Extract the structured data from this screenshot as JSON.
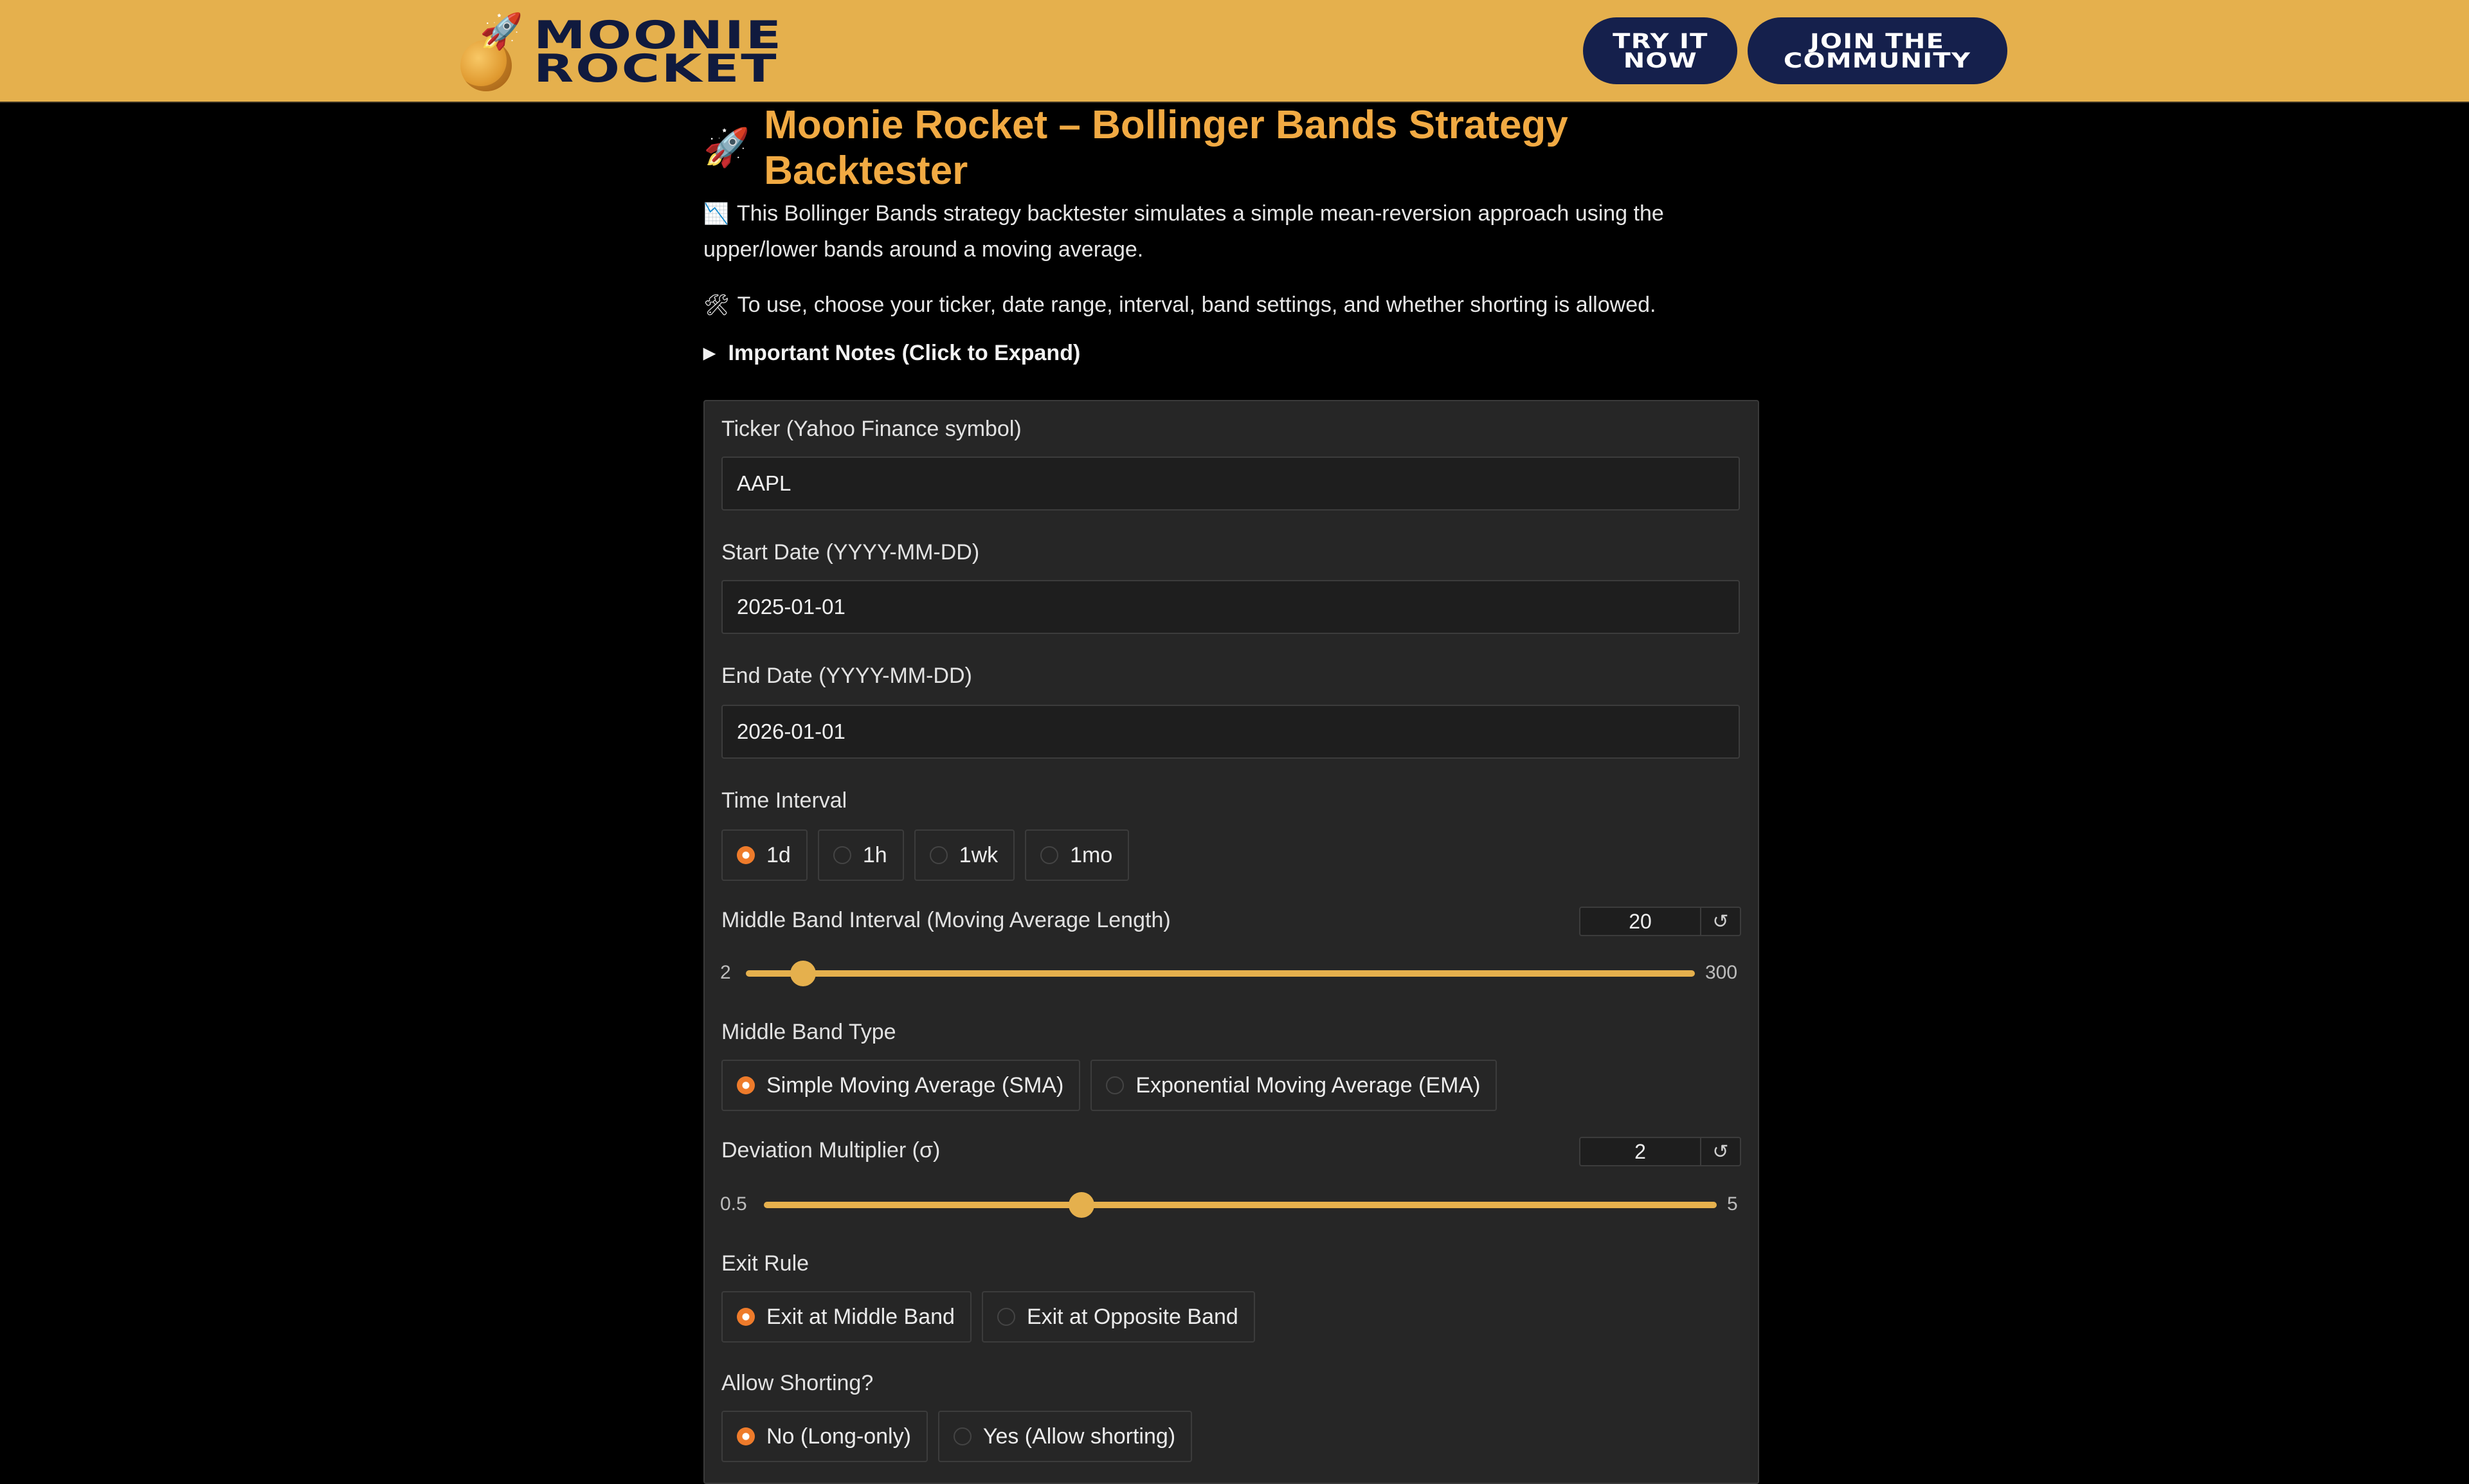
{
  "header": {
    "logo_line1": "MOONIE",
    "logo_line2": "ROCKET",
    "try_button": "TRY IT\nNOW",
    "join_button": "JOIN THE\nCOMMUNITY"
  },
  "page": {
    "title_emoji": "🚀",
    "title": "Moonie Rocket – Bollinger Bands Strategy Backtester",
    "intro_emoji": "📉",
    "intro_line1": "This Bollinger Bands strategy backtester simulates a simple mean-reversion approach using the",
    "intro_line2": "upper/lower bands around a moving average.",
    "usage_emoji": "🛠",
    "usage": "To use, choose your ticker, date range, interval, band settings, and whether shorting is allowed.",
    "notes_toggle": "Important Notes (Click to Expand)"
  },
  "form": {
    "ticker_label": "Ticker (Yahoo Finance symbol)",
    "ticker_value": "AAPL",
    "start_label": "Start Date (YYYY-MM-DD)",
    "start_value": "2025-01-01",
    "end_label": "End Date (YYYY-MM-DD)",
    "end_value": "2026-01-01",
    "interval_label": "Time Interval",
    "interval_options": [
      "1d",
      "1h",
      "1wk",
      "1mo"
    ],
    "interval_selected": "1d",
    "ma_label": "Middle Band Interval (Moving Average Length)",
    "ma_value": "20",
    "ma_min": "2",
    "ma_max": "300",
    "ma_fraction": 0.0604,
    "band_type_label": "Middle Band Type",
    "band_type_options": [
      "Simple Moving Average (SMA)",
      "Exponential Moving Average (EMA)"
    ],
    "band_type_selected": "Simple Moving Average (SMA)",
    "dev_label": "Deviation Multiplier (σ)",
    "dev_value": "2",
    "dev_min": "0.5",
    "dev_max": "5",
    "dev_fraction": 0.3333,
    "exit_label": "Exit Rule",
    "exit_options": [
      "Exit at Middle Band",
      "Exit at Opposite Band"
    ],
    "exit_selected": "Exit at Middle Band",
    "short_label": "Allow Shorting?",
    "short_options": [
      "No (Long-only)",
      "Yes (Allow shorting)"
    ],
    "short_selected": "No (Long-only)",
    "reset_icon": "↺"
  },
  "colors": {
    "header_bg": "#e5b04d",
    "accent_orange": "#ee7b2b",
    "title_orange": "#f1aa43",
    "navy": "#15204c"
  }
}
